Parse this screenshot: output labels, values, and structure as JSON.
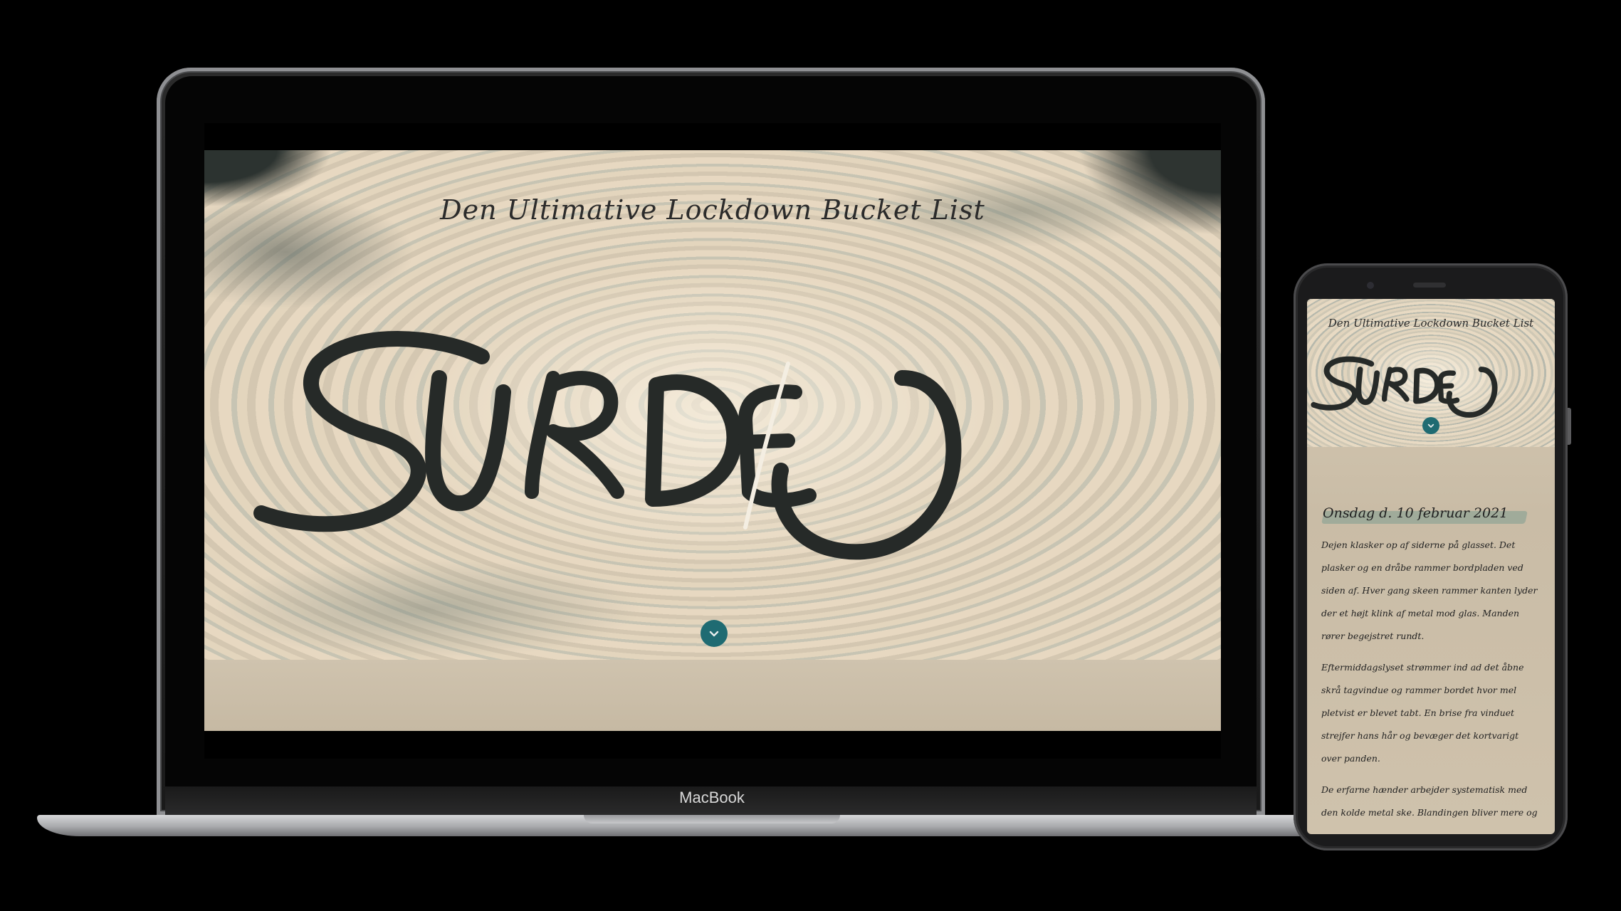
{
  "site": {
    "title": "Den Ultimative Lockdown Bucket List",
    "hero_word": "SURDEJ"
  },
  "laptop": {
    "brand_label": "MacBook"
  },
  "phone": {
    "date_heading": "Onsdag d. 10 februar 2021",
    "paragraphs": [
      "Dejen klasker op af siderne på glasset. Det plasker og en dråbe rammer bordpladen ved siden af. Hver gang skeen rammer kanten lyder der et højt klink af metal mod glas. Manden rører begejstret rundt.",
      "Eftermiddagslyset strømmer ind ad det åbne skrå tagvindue og rammer bordet hvor mel pletvist er blevet tabt. En brise fra vinduet strejfer hans hår og bevæger det kortvarigt over panden.",
      "De erfarne hænder arbejder systematisk med den kolde metal ske. Blandingen bliver mere og"
    ]
  },
  "colors": {
    "accent": "#1f6b72",
    "flour": "#e4d5bd",
    "paper": "#cfc3ae",
    "ink": "#2b2b2b"
  },
  "icons": {
    "scroll_down": "chevron-down-icon"
  }
}
